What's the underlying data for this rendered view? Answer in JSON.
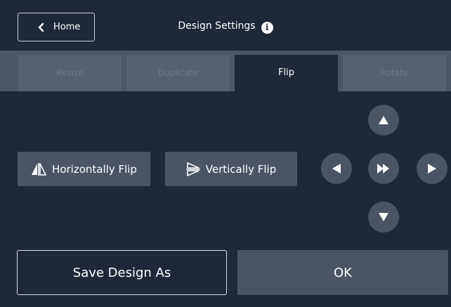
{
  "header": {
    "home_label": "Home",
    "title": "Design Settings",
    "info_glyph": "i"
  },
  "tabs": [
    {
      "label": "Resize",
      "active": false
    },
    {
      "label": "Duplicate",
      "active": false
    },
    {
      "label": "Flip",
      "active": true
    },
    {
      "label": "Rotate",
      "active": false
    }
  ],
  "flip": {
    "horizontal_label": "Horizontally Flip",
    "vertical_label": "Vertically Flip"
  },
  "direction_pad": {
    "up_icon": "triangle-up-icon",
    "down_icon": "triangle-down-icon",
    "left_icon": "triangle-left-icon",
    "right_icon": "triangle-right-icon",
    "center_icon": "fast-forward-icon"
  },
  "footer": {
    "save_label": "Save Design As",
    "ok_label": "OK"
  },
  "colors": {
    "background": "#1f2837",
    "tab_bar": "#4b5666",
    "button": "#4a5463"
  }
}
